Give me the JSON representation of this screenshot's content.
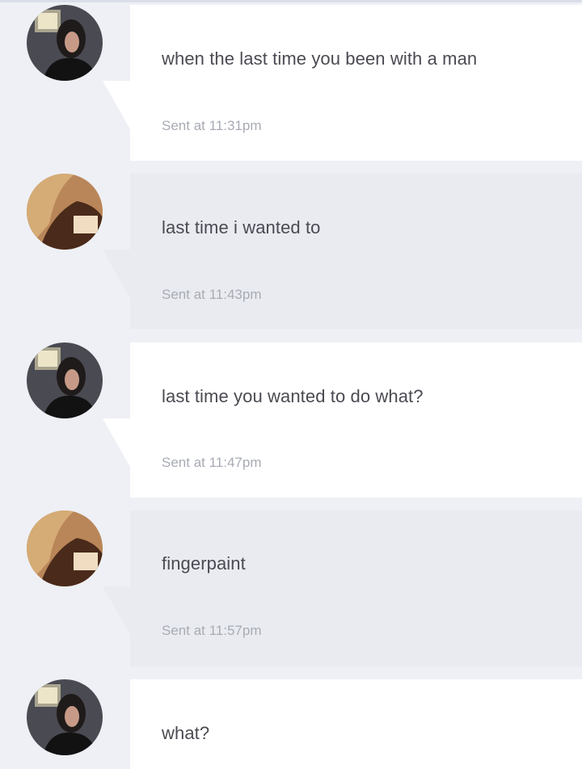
{
  "messages": [
    {
      "sender": "man",
      "text": "when the last time you been with a man",
      "sent": "Sent at 11:31pm"
    },
    {
      "sender": "woman",
      "text": "last time i wanted to",
      "sent": "Sent at 11:43pm"
    },
    {
      "sender": "man",
      "text": "last time you wanted to do what?",
      "sent": "Sent at 11:47pm"
    },
    {
      "sender": "woman",
      "text": "fingerpaint",
      "sent": "Sent at 11:57pm"
    },
    {
      "sender": "man",
      "text": "what?",
      "sent": ""
    }
  ],
  "colors": {
    "background": "#eef0f5",
    "bubble_sent": "#ffffff",
    "bubble_received": "#e9ebf1",
    "message_text": "#4a4a52",
    "timestamp_text": "#a7abb3"
  },
  "icons": {
    "man_avatar": "avatar-man-photo-icon",
    "woman_avatar": "avatar-woman-photo-icon"
  }
}
